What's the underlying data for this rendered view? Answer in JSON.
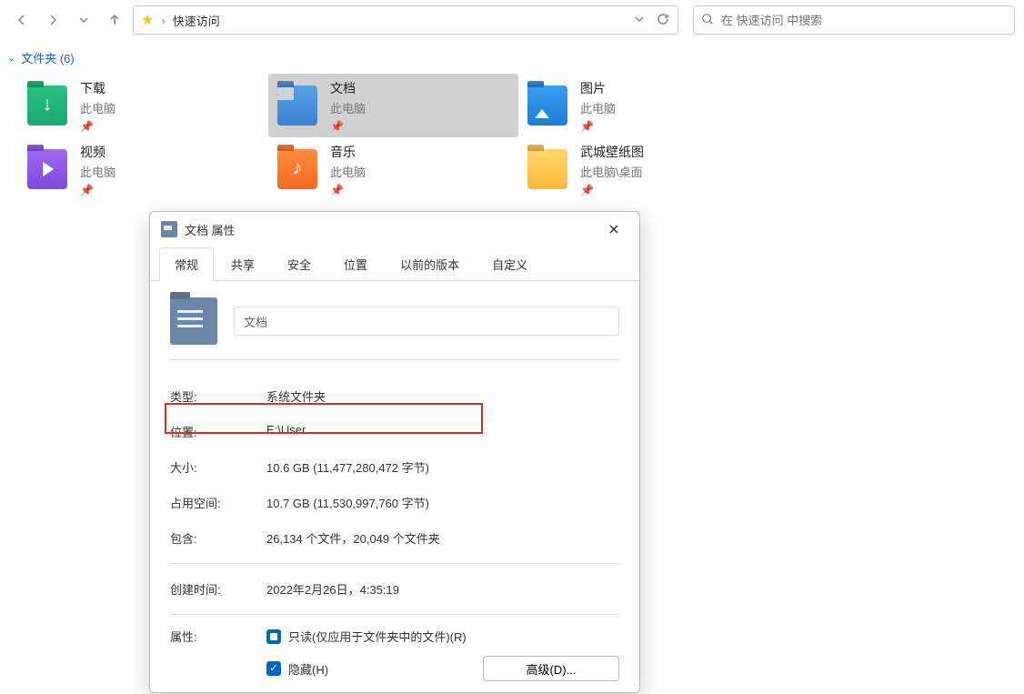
{
  "address": {
    "path": "快速访问",
    "separator": "›"
  },
  "search": {
    "placeholder": "在 快速访问 中搜索"
  },
  "section": {
    "label": "文件夹 (6)"
  },
  "folders": [
    {
      "name": "下载",
      "sub": "此电脑",
      "iconClass": "fi-download"
    },
    {
      "name": "文档",
      "sub": "此电脑",
      "iconClass": "fi-docs",
      "selected": true
    },
    {
      "name": "图片",
      "sub": "此电脑",
      "iconClass": "fi-pics"
    },
    {
      "name": "视频",
      "sub": "此电脑",
      "iconClass": "fi-video"
    },
    {
      "name": "音乐",
      "sub": "此电脑",
      "iconClass": "fi-music"
    },
    {
      "name": "武城壁纸图",
      "sub": "此电脑\\桌面",
      "iconClass": "fi-plain"
    }
  ],
  "dialog": {
    "title": "文档 属性",
    "tabs": [
      "常规",
      "共享",
      "安全",
      "位置",
      "以前的版本",
      "自定义"
    ],
    "activeTab": 0,
    "nameValue": "文档",
    "rows": {
      "type_label": "类型:",
      "type_value": "系统文件夹",
      "location_label": "位置:",
      "location_value": "E:\\User",
      "size_label": "大小:",
      "size_value": "10.6 GB (11,477,280,472 字节)",
      "sizeOnDisk_label": "占用空间:",
      "sizeOnDisk_value": "10.7 GB (11,530,997,760 字节)",
      "contains_label": "包含:",
      "contains_value": "26,134 个文件，20,049 个文件夹",
      "created_label": "创建时间:",
      "created_value": "2022年2月26日，4:35:19",
      "attr_label": "属性:",
      "readonly_label": "只读(仅应用于文件夹中的文件)(R)",
      "hidden_label": "隐藏(H)",
      "advanced_label": "高级(D)..."
    }
  }
}
